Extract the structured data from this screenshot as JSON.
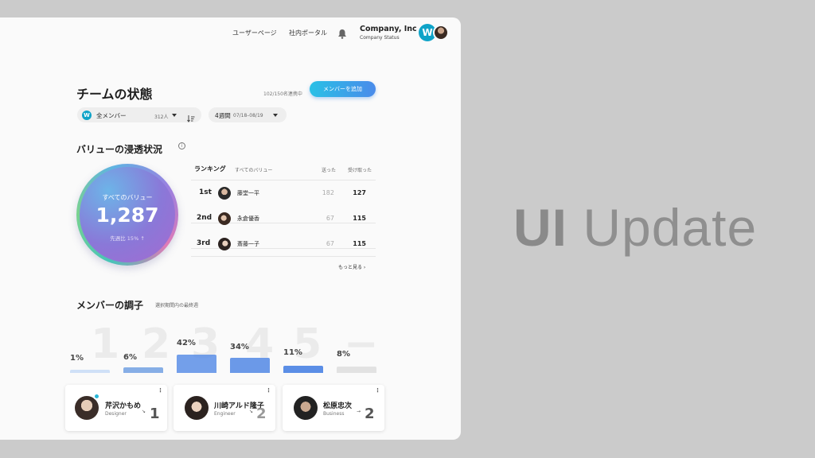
{
  "topnav": {
    "user_page": "ユーザーページ",
    "portal": "社内ポータル",
    "company_name": "Company, Inc",
    "company_status": "Company Status",
    "logo_letter": "W"
  },
  "header": {
    "title": "チームの状態",
    "member_count": "102/150名連携中",
    "add_button": "メンバーを追加"
  },
  "filters": {
    "member_filter": {
      "logo": "W",
      "label": "全メンバー",
      "count": "312人"
    },
    "period_filter": {
      "label": "4週間",
      "range": "07/18–08/19"
    }
  },
  "values_section": {
    "title": "バリューの浸透状況",
    "info": "i",
    "circle_label": "すべてのバリュー",
    "circle_value": "1,287",
    "circle_delta": "先週比 15% ↑"
  },
  "ranking": {
    "title": "ランキング",
    "subtitle": "すべてのバリュー",
    "col_sent": "送った",
    "col_received": "受け取った",
    "rows": [
      {
        "rank": "1st",
        "name": "藤堂一平",
        "sent": "182",
        "received": "127"
      },
      {
        "rank": "2nd",
        "name": "永倉優香",
        "sent": "67",
        "received": "115"
      },
      {
        "rank": "3rd",
        "name": "斎藤一子",
        "sent": "67",
        "received": "115"
      }
    ],
    "more_link": "もっと見る ›"
  },
  "condition_section": {
    "title": "メンバーの調子",
    "subtitle": "選択期間内の最終週",
    "levels": [
      {
        "big": "1",
        "pct": "1%",
        "value": 1
      },
      {
        "big": "2",
        "pct": "6%",
        "value": 6
      },
      {
        "big": "3",
        "pct": "42%",
        "value": 42
      },
      {
        "big": "4",
        "pct": "34%",
        "value": 34
      },
      {
        "big": "5",
        "pct": "11%",
        "value": 11
      },
      {
        "big": "−",
        "pct": "8%",
        "value": 8
      }
    ]
  },
  "member_cards": [
    {
      "name": "芹沢かもめ",
      "role": "Designer",
      "score": "1",
      "arrow": "↘"
    },
    {
      "name": "川崎アルド隆子",
      "role": "Engineer",
      "score": "2",
      "arrow": "↘"
    },
    {
      "name": "松原忠次",
      "role": "Business",
      "score": "2",
      "arrow": "→"
    }
  ],
  "overlay": {
    "bold": "UI",
    "rest": " Update"
  },
  "colors": {
    "accent": "#0fa3c8",
    "button_gradient_start": "#29c0e6",
    "button_gradient_end": "#4a8bea",
    "bar_light": "#cfe0f7",
    "bar_mid": "#86aee6",
    "bar_strong": "#5b8ee6",
    "bar_neutral": "#e2e2e2"
  },
  "icons": [
    "bell-icon",
    "sort-icon",
    "info-icon",
    "arrow-up-icon",
    "more-vert-icon",
    "status-dot-icon"
  ]
}
